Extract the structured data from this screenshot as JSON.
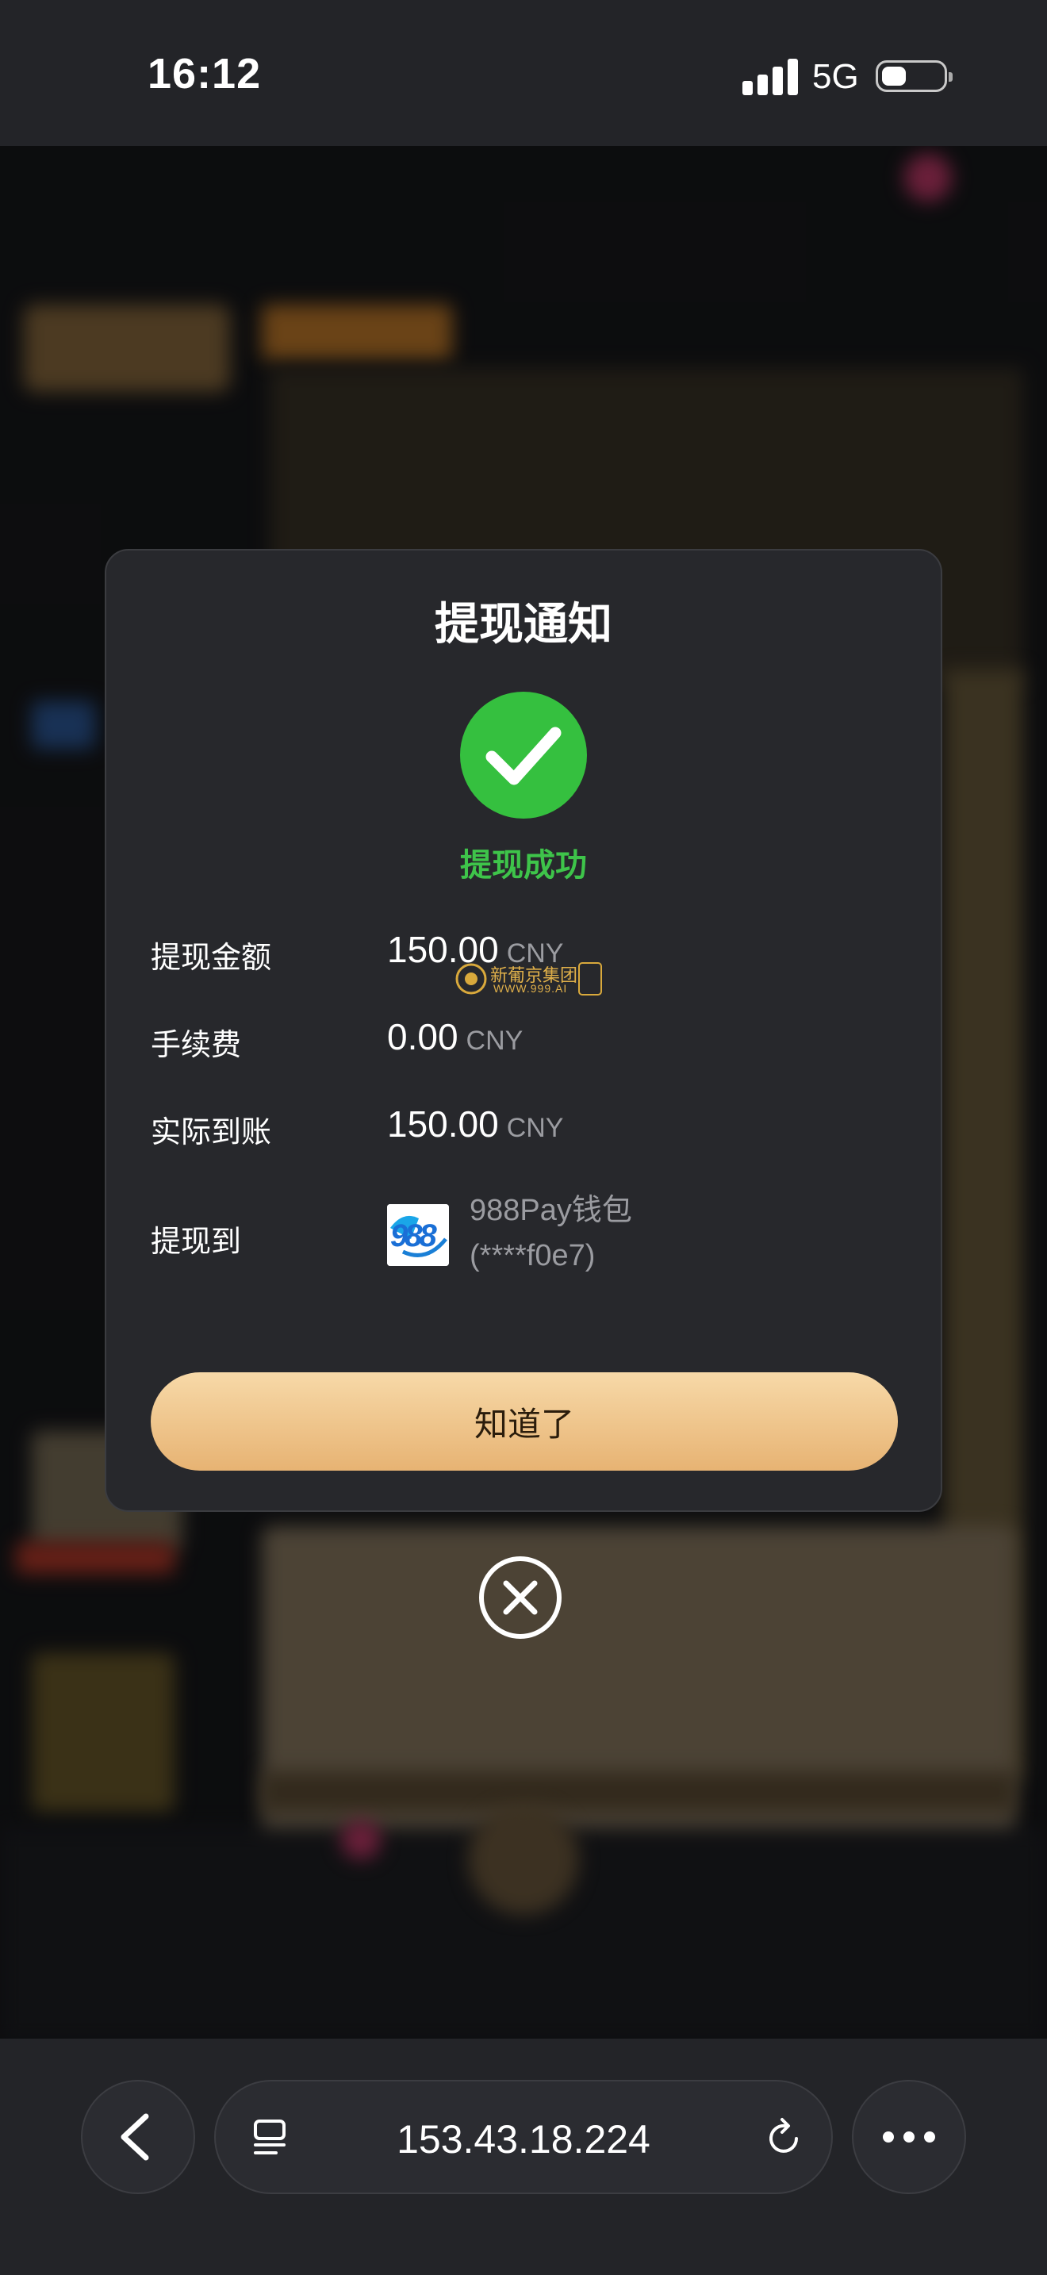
{
  "status_bar": {
    "time": "16:12",
    "network": "5G"
  },
  "dialog": {
    "title": "提现通知",
    "success_text": "提现成功",
    "rows": [
      {
        "label": "提现金额",
        "value": "150.00",
        "currency": "CNY"
      },
      {
        "label": "手续费",
        "value": "0.00",
        "currency": "CNY"
      },
      {
        "label": "实际到账",
        "value": "150.00",
        "currency": "CNY"
      }
    ],
    "destination": {
      "label": "提现到",
      "wallet_name": "988Pay钱包",
      "account": "(****f0e7)",
      "logo_text": "988"
    },
    "watermark_text": "新葡京集团",
    "watermark_sub": "WWW.999.AI",
    "ok_button": "知道了"
  },
  "browser": {
    "url": "153.43.18.224"
  },
  "colors": {
    "accent_green": "#35c03f",
    "button_gold": "#e7b373"
  }
}
